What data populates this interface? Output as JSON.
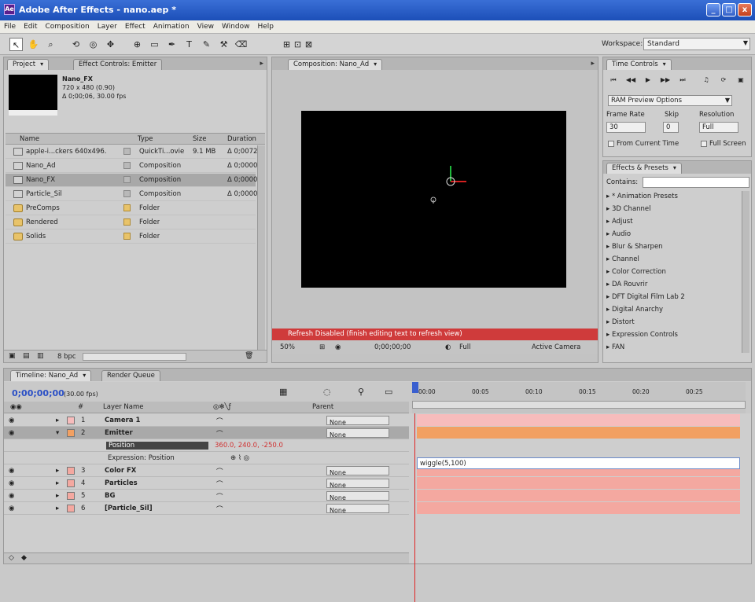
{
  "window": {
    "title": "Adobe After Effects - nano.aep *",
    "app_icon": "Ae",
    "buttons": [
      "_",
      "□",
      "x"
    ]
  },
  "menu": [
    "File",
    "Edit",
    "Composition",
    "Layer",
    "Effect",
    "Animation",
    "View",
    "Window",
    "Help"
  ],
  "toolbar": {
    "workspace_label": "Workspace:",
    "workspace_value": "Standard"
  },
  "project": {
    "tabs": [
      {
        "label": "Project"
      },
      {
        "label": "Effect Controls: Emitter"
      }
    ],
    "item_name": "Nano_FX",
    "item_info": [
      "720 x 480 (0.90)",
      "Δ 0;00;06, 30.00 fps"
    ],
    "columns": {
      "name": "Name",
      "type": "Type",
      "size": "Size",
      "duration": "Duration"
    },
    "rows": [
      {
        "name": "apple-i...ckers 640x496.",
        "type": "QuickTi...ovie",
        "size": "9.1 MB",
        "duration": "Δ 0;0072",
        "kind": "footage"
      },
      {
        "name": "Nano_Ad",
        "type": "Composition",
        "size": "",
        "duration": "Δ 0;0000",
        "kind": "comp"
      },
      {
        "name": "Nano_FX",
        "type": "Composition",
        "size": "",
        "duration": "Δ 0;0000",
        "kind": "comp"
      },
      {
        "name": "Particle_Sil",
        "type": "Composition",
        "size": "",
        "duration": "Δ 0;0000",
        "kind": "comp"
      },
      {
        "name": "PreComps",
        "type": "Folder",
        "size": "",
        "duration": "",
        "kind": "folder"
      },
      {
        "name": "Rendered",
        "type": "Folder",
        "size": "",
        "duration": "",
        "kind": "folder"
      },
      {
        "name": "Solids",
        "type": "Folder",
        "size": "",
        "duration": "",
        "kind": "folder"
      }
    ],
    "bottom_bpc": "8 bpc"
  },
  "composition": {
    "tab": "Composition: Nano_Ad",
    "refresh_msg": "Refresh Disabled (finish editing text to refresh view)",
    "zoom": "50%",
    "timecode": "0;00;00;00",
    "resolution": "Full",
    "view": "Active Camera"
  },
  "time_controls": {
    "tab": "Time Controls",
    "preview_options": "RAM Preview Options",
    "frame_rate_label": "Frame Rate",
    "skip_label": "Skip",
    "resolution_label": "Resolution",
    "frame_rate": "30",
    "skip": "0",
    "resolution": "Full",
    "from_current": "From Current Time",
    "full_screen": "Full Screen"
  },
  "effects": {
    "tab": "Effects & Presets",
    "contains_label": "Contains:",
    "items": [
      "* Animation Presets",
      "3D Channel",
      "Adjust",
      "Audio",
      "Blur & Sharpen",
      "Channel",
      "Color Correction",
      "DA Rouvrir",
      "DFT Digital Film Lab 2",
      "Digital Anarchy",
      "Distort",
      "Expression Controls",
      "FAN"
    ]
  },
  "timeline": {
    "tabs": [
      {
        "label": "Timeline: Nano_Ad"
      },
      {
        "label": "Render Queue"
      }
    ],
    "timecode": "0;00;00;00",
    "fps": "(30.00 fps)",
    "col_layer": "Layer Name",
    "col_parent": "Parent",
    "ruler_ticks": [
      "00:00",
      "00:05",
      "00:10",
      "00:15",
      "00:20",
      "00:25"
    ],
    "layers": [
      {
        "num": "1",
        "name": "Camera 1",
        "parent": "None",
        "color": "#f7bcbc"
      },
      {
        "num": "2",
        "name": "Emitter",
        "parent": "None",
        "color": "#f2a062"
      },
      {
        "num": "3",
        "name": "Color FX",
        "parent": "None",
        "color": "#f4a8a0"
      },
      {
        "num": "4",
        "name": "Particles",
        "parent": "None",
        "color": "#f4a8a0"
      },
      {
        "num": "5",
        "name": "BG",
        "parent": "None",
        "color": "#f4a8a0"
      },
      {
        "num": "6",
        "name": "[Particle_Sil]",
        "parent": "None",
        "color": "#f4a8a0"
      }
    ],
    "property_name": "Position",
    "property_value": "360.0, 240.0, -250.0",
    "expression_label": "Expression: Position",
    "expression_text": "wiggle(5,100)"
  }
}
